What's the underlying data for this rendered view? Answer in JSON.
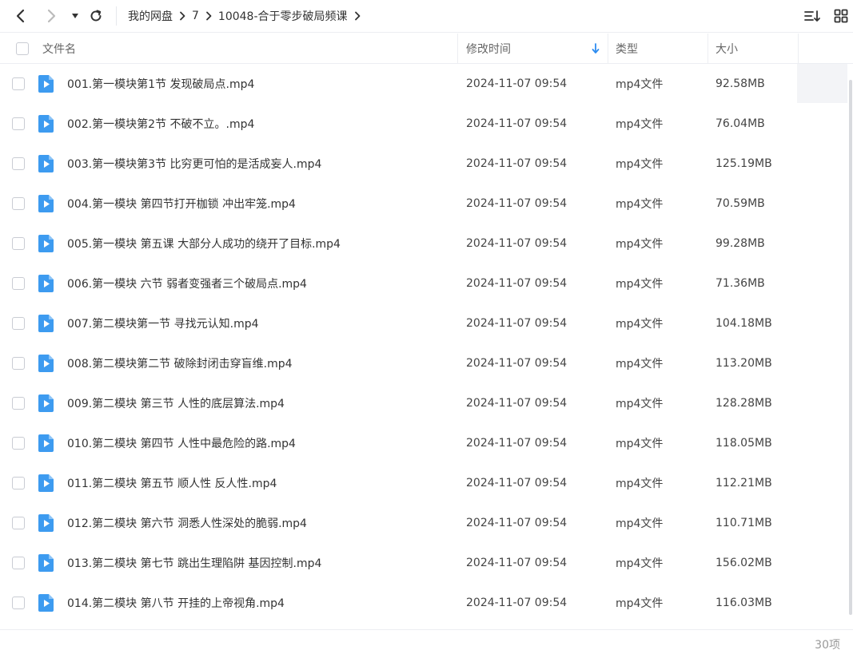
{
  "toolbar": {
    "back_icon": "chevron-left-icon",
    "forward_icon": "chevron-right-icon",
    "dropdown_icon": "caret-down-icon",
    "refresh_icon": "refresh-icon",
    "breadcrumb": [
      "我的网盘",
      "7",
      "10048-合于零步破局频课"
    ],
    "sort_icon": "sort-list-icon",
    "grid_icon": "grid-view-icon"
  },
  "header": {
    "name": "文件名",
    "time": "修改时间",
    "type": "类型",
    "size": "大小",
    "sort_arrow_color": "#2d8cf0"
  },
  "files": [
    {
      "name": "001.第一模块第1节 发现破局点.mp4",
      "time": "2024-11-07 09:54",
      "type": "mp4文件",
      "size": "92.58MB"
    },
    {
      "name": "002.第一模块第2节 不破不立。.mp4",
      "time": "2024-11-07 09:54",
      "type": "mp4文件",
      "size": "76.04MB"
    },
    {
      "name": "003.第一模块第3节 比穷更可怕的是活成妄人.mp4",
      "time": "2024-11-07 09:54",
      "type": "mp4文件",
      "size": "125.19MB"
    },
    {
      "name": "004.第一模块 第四节打开枷锁 冲出牢笼.mp4",
      "time": "2024-11-07 09:54",
      "type": "mp4文件",
      "size": "70.59MB"
    },
    {
      "name": "005.第一模块 第五课 大部分人成功的绕开了目标.mp4",
      "time": "2024-11-07 09:54",
      "type": "mp4文件",
      "size": "99.28MB"
    },
    {
      "name": "006.第一模块 六节 弱者变强者三个破局点.mp4",
      "time": "2024-11-07 09:54",
      "type": "mp4文件",
      "size": "71.36MB"
    },
    {
      "name": "007.第二模块第一节 寻找元认知.mp4",
      "time": "2024-11-07 09:54",
      "type": "mp4文件",
      "size": "104.18MB"
    },
    {
      "name": "008.第二模块第二节 破除封闭击穿盲维.mp4",
      "time": "2024-11-07 09:54",
      "type": "mp4文件",
      "size": "113.20MB"
    },
    {
      "name": "009.第二模块 第三节 人性的底层算法.mp4",
      "time": "2024-11-07 09:54",
      "type": "mp4文件",
      "size": "128.28MB"
    },
    {
      "name": "010.第二模块 第四节 人性中最危险的路.mp4",
      "time": "2024-11-07 09:54",
      "type": "mp4文件",
      "size": "118.05MB"
    },
    {
      "name": "011.第二模块 第五节 顺人性 反人性.mp4",
      "time": "2024-11-07 09:54",
      "type": "mp4文件",
      "size": "112.21MB"
    },
    {
      "name": "012.第二模块 第六节 洞悉人性深处的脆弱.mp4",
      "time": "2024-11-07 09:54",
      "type": "mp4文件",
      "size": "110.71MB"
    },
    {
      "name": "013.第二模块 第七节 跳出生理陷阱 基因控制.mp4",
      "time": "2024-11-07 09:54",
      "type": "mp4文件",
      "size": "156.02MB"
    },
    {
      "name": "014.第二模块 第八节 开挂的上帝视角.mp4",
      "time": "2024-11-07 09:54",
      "type": "mp4文件",
      "size": "116.03MB"
    }
  ],
  "file_icon": "video-file-icon",
  "file_icon_color": "#3d9bf0",
  "footer": {
    "count": "30项"
  }
}
